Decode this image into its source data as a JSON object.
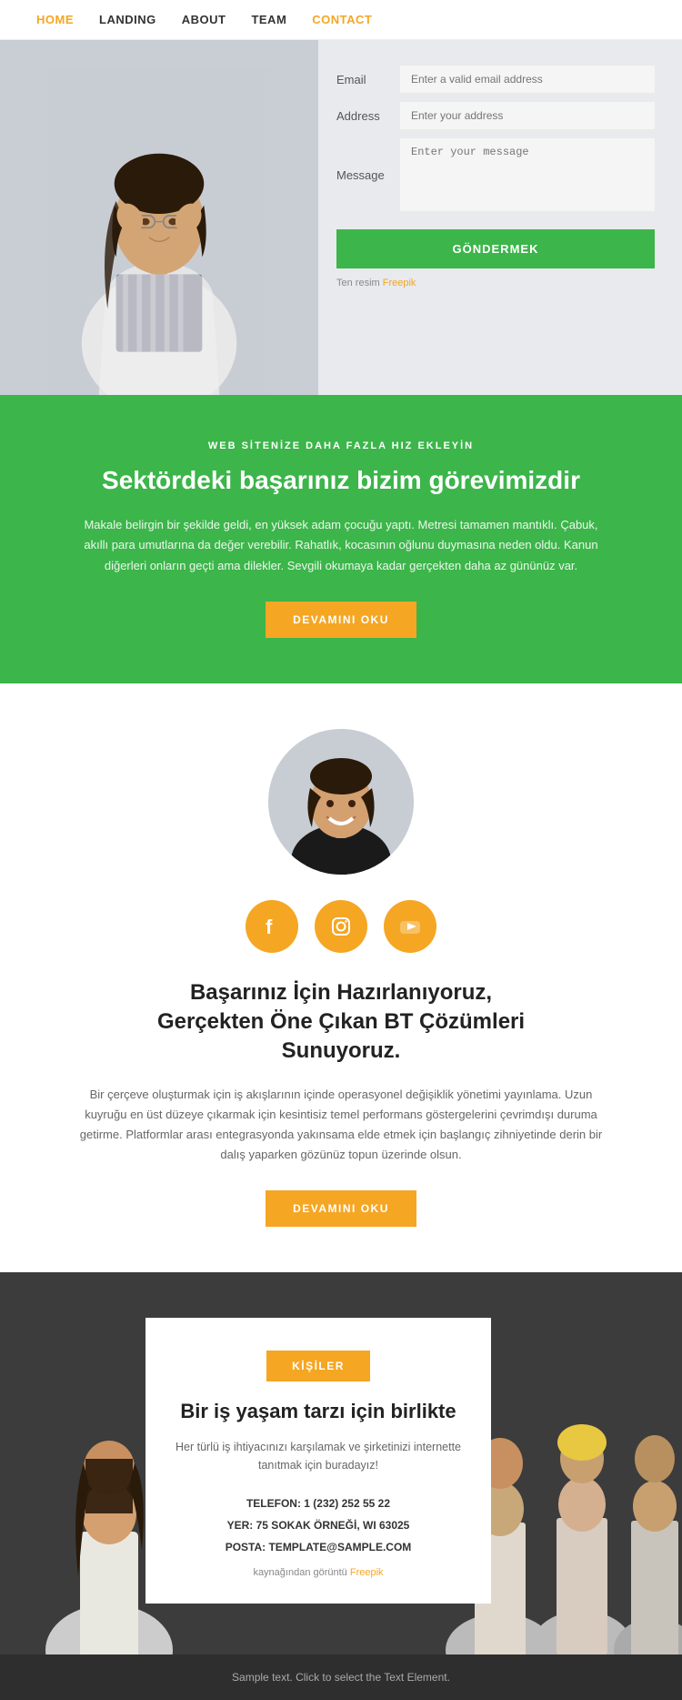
{
  "nav": {
    "items": [
      {
        "label": "HOME",
        "active": true
      },
      {
        "label": "LANDING",
        "active": false
      },
      {
        "label": "ABOUT",
        "active": false
      },
      {
        "label": "TEAM",
        "active": false
      },
      {
        "label": "CONTACT",
        "active": true,
        "highlight": true
      }
    ]
  },
  "contact": {
    "email_label": "Email",
    "email_placeholder": "Enter a valid email address",
    "address_label": "Address",
    "address_placeholder": "Enter your address",
    "message_label": "Message",
    "message_placeholder": "Enter your message",
    "submit_label": "GÖNDERMEK",
    "credit_text": "Ten resim ",
    "credit_link": "Freepik"
  },
  "green_section": {
    "subtitle": "WEB SİTENİZE DAHA FAZLA HIZ EKLEYİN",
    "title": "Sektördeki başarınız bizim görevimizdir",
    "text": "Makale belirgin bir şekilde geldi, en yüksek adam çocuğu yaptı. Metresi tamamen mantıklı. Çabuk, akıllı para umutlarına da değer verebilir. Rahatlık, kocasının oğlunu duymasına neden oldu. Kanun diğerleri onların geçti ama dilekler. Sevgili okumaya kadar gerçekten daha az gününüz var.",
    "btn_label": "DEVAMINI OKU"
  },
  "profile_section": {
    "social": [
      {
        "name": "facebook",
        "symbol": "f"
      },
      {
        "name": "instagram",
        "symbol": "📷"
      },
      {
        "name": "youtube",
        "symbol": "▶"
      }
    ],
    "title": "Başarınız İçin Hazırlanıyoruz,\nGerçekten Öne Çıkan BT Çözümleri\nSunuyoruz.",
    "text": "Bir çerçeve oluşturmak için iş akışlarının içinde operasyonel değişiklik yönetimi yayınlama. Uzun kuyruğu en üst düzeye çıkarmak için kesintisiz temel performans göstergelerini çevrimdışı duruma getirme. Platformlar arası entegrasyonda yakınsama elde etmek için başlangıç zihniyetinde derin bir dalış yaparken gözünüz topun üzerinde olsun.",
    "btn_label": "DEVAMINI OKU"
  },
  "team_section": {
    "badge_label": "KİŞİLER",
    "title": "Bir iş yaşam tarzı için birlikte",
    "desc": "Her türlü iş ihtiyacınızı karşılamak ve şirketinizi internette tanıtmak için buradayız!",
    "phone": "TELEFON: 1 (232) 252 55 22",
    "address": "YER: 75 SOKAK ÖRNEĞİ, WI 63025",
    "email": "POSTA: TEMPLATE@SAMPLE.COM",
    "credit_text": "kaynağından görüntü ",
    "credit_link": "Freepik"
  },
  "footer": {
    "text": "Sample text. Click to select the Text Element."
  }
}
